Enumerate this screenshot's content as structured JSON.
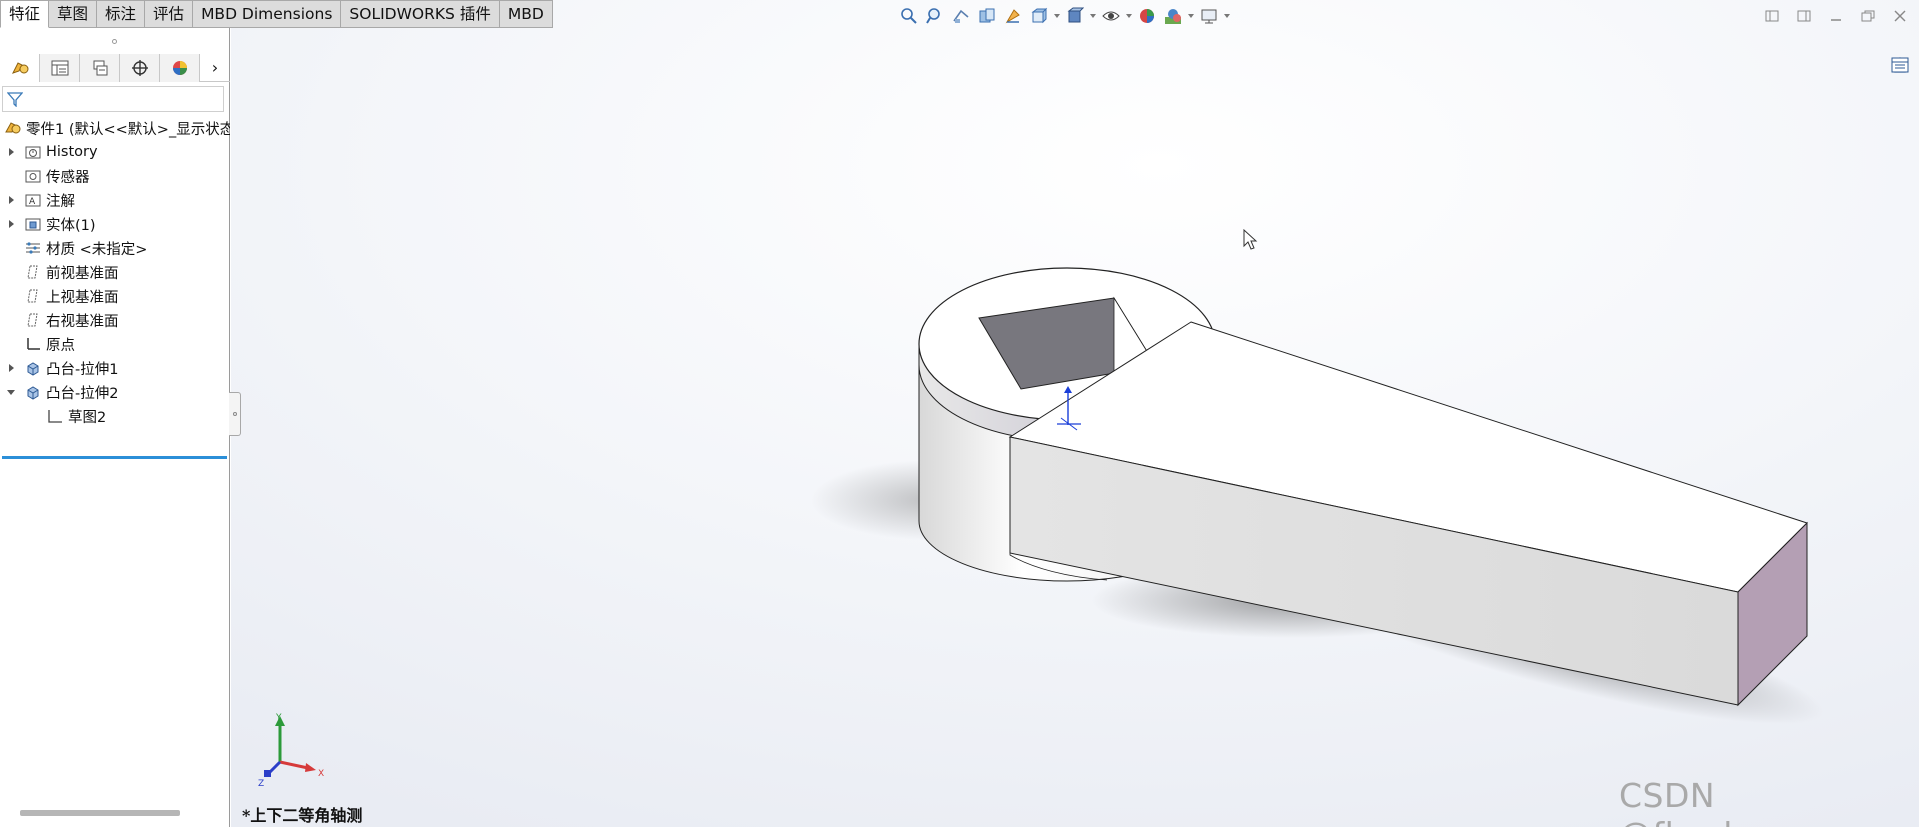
{
  "command_tabs": [
    {
      "label": "特征",
      "active": true
    },
    {
      "label": "草图",
      "active": false
    },
    {
      "label": "标注",
      "active": false
    },
    {
      "label": "评估",
      "active": false
    },
    {
      "label": "MBD Dimensions",
      "active": false
    },
    {
      "label": "SOLIDWORKS 插件",
      "active": false
    },
    {
      "label": "MBD",
      "active": false
    }
  ],
  "heads_up_toolbar": [
    "zoom-to-fit-icon",
    "zoom-area-icon",
    "previous-view-icon",
    "section-view-icon",
    "dynamic-annotation-icon",
    "view-orientation-icon",
    "display-style-icon",
    "hide-show-icon",
    "edit-appearance-icon",
    "apply-scene-icon",
    "view-settings-icon"
  ],
  "manager_tabs": [
    "featuremanager-icon",
    "propertymanager-icon",
    "configurationmanager-icon",
    "dimxpert-icon",
    "display-manager-icon"
  ],
  "feature_tree": {
    "root": "零件1 (默认<<默认>_显示状态",
    "items": [
      {
        "label": "History",
        "icon": "history-folder-icon",
        "expander": "right"
      },
      {
        "label": "传感器",
        "icon": "sensor-icon",
        "expander": "none"
      },
      {
        "label": "注解",
        "icon": "annotation-icon",
        "expander": "right"
      },
      {
        "label": "实体(1)",
        "icon": "solid-bodies-icon",
        "expander": "right"
      },
      {
        "label": "材质 <未指定>",
        "icon": "material-icon",
        "expander": "none"
      },
      {
        "label": "前视基准面",
        "icon": "plane-icon",
        "expander": "none"
      },
      {
        "label": "上视基准面",
        "icon": "plane-icon",
        "expander": "none"
      },
      {
        "label": "右视基准面",
        "icon": "plane-icon",
        "expander": "none"
      },
      {
        "label": "原点",
        "icon": "origin-icon",
        "expander": "none"
      },
      {
        "label": "凸台-拉伸1",
        "icon": "extrude-icon",
        "expander": "right"
      },
      {
        "label": "凸台-拉伸2",
        "icon": "extrude-icon",
        "expander": "down"
      }
    ],
    "child": {
      "label": "草图2",
      "icon": "sketch-icon"
    }
  },
  "view_name": "*上下二等角轴测",
  "watermark": "CSDN @fly_daerm",
  "triad": {
    "x": "X",
    "y": "Y",
    "z": "Z"
  },
  "colors": {
    "accent_blue": "#2b8fd8",
    "model_face": "#ffffff",
    "model_side": "#dedede",
    "model_end": "#b49fb4",
    "hole_inner": "#7a7a80"
  }
}
